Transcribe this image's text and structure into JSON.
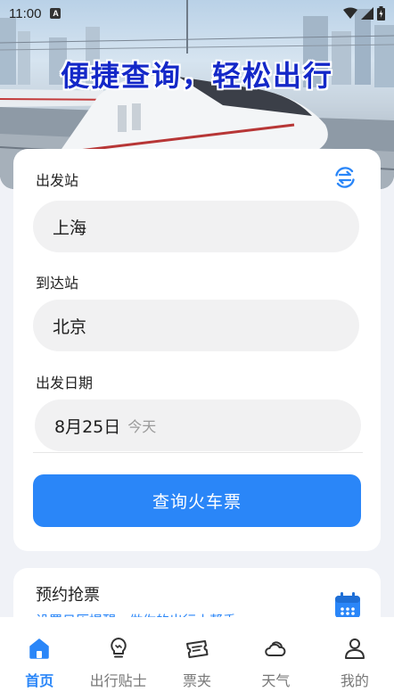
{
  "status_bar": {
    "time": "11:00",
    "notification_glyph": "A"
  },
  "hero": {
    "title": "便捷查询，轻松出行"
  },
  "search": {
    "departure_label": "出发站",
    "departure_value": "上海",
    "arrival_label": "到达站",
    "arrival_value": "北京",
    "date_label": "出发日期",
    "date_value": "8月25日",
    "date_sub": "今天",
    "submit_label": "查询火车票"
  },
  "reserve": {
    "title": "预约抢票",
    "subtitle": "设置日历提醒，做你的出行小帮手"
  },
  "nav": {
    "items": [
      {
        "label": "首页",
        "icon": "home-icon",
        "active": true
      },
      {
        "label": "出行贴士",
        "icon": "lightbulb-icon",
        "active": false
      },
      {
        "label": "票夹",
        "icon": "ticket-icon",
        "active": false
      },
      {
        "label": "天气",
        "icon": "weather-icon",
        "active": false
      },
      {
        "label": "我的",
        "icon": "user-icon",
        "active": false
      }
    ]
  },
  "colors": {
    "accent": "#2a86f8",
    "hero_title": "#1428c8",
    "page_bg": "#f0f2f7",
    "field_bg": "#f1f1f2"
  }
}
